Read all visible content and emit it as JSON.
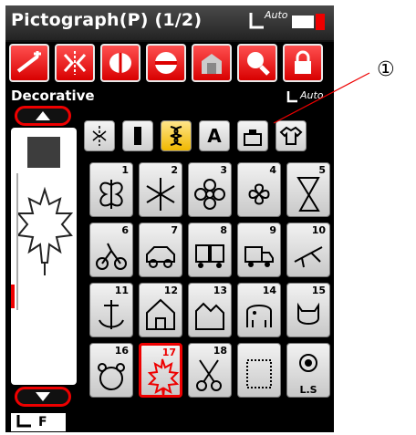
{
  "header": {
    "title": "Pictograph(P) (1/2)",
    "auto_label": "Auto"
  },
  "toolbar": {
    "buttons": [
      {
        "icon": "edit-pen-icon"
      },
      {
        "icon": "mirror-icon"
      },
      {
        "icon": "elongation-icon"
      },
      {
        "icon": "image-split-icon"
      },
      {
        "icon": "memory-icon"
      },
      {
        "icon": "zoom-icon"
      },
      {
        "icon": "lock-icon"
      }
    ]
  },
  "section": {
    "label": "Decorative",
    "auto_label": "Auto"
  },
  "tabs": [
    {
      "icon": "straight-stitch-icon",
      "selected": false
    },
    {
      "icon": "satin-icon",
      "selected": false
    },
    {
      "icon": "decorative-icon",
      "selected": true
    },
    {
      "label": "A",
      "selected": false
    },
    {
      "icon": "pictograph-icon",
      "selected": false
    },
    {
      "icon": "shirt-icon",
      "selected": false
    }
  ],
  "patterns": [
    {
      "number": "1"
    },
    {
      "number": "2"
    },
    {
      "number": "3"
    },
    {
      "number": "4"
    },
    {
      "number": "5"
    },
    {
      "number": "6"
    },
    {
      "number": "7"
    },
    {
      "number": "8"
    },
    {
      "number": "9"
    },
    {
      "number": "10"
    },
    {
      "number": "11"
    },
    {
      "number": "12"
    },
    {
      "number": "13"
    },
    {
      "number": "14"
    },
    {
      "number": "15"
    },
    {
      "number": "16"
    },
    {
      "number": "17",
      "selected": true
    },
    {
      "number": "18"
    },
    {
      "number": ""
    },
    {
      "label": "L.S"
    }
  ],
  "footer": {
    "foot_label": "F"
  },
  "callout": {
    "number": "①"
  },
  "colors": {
    "accent": "#e00000",
    "selected_tab": "#f0b800",
    "background": "#000000"
  }
}
